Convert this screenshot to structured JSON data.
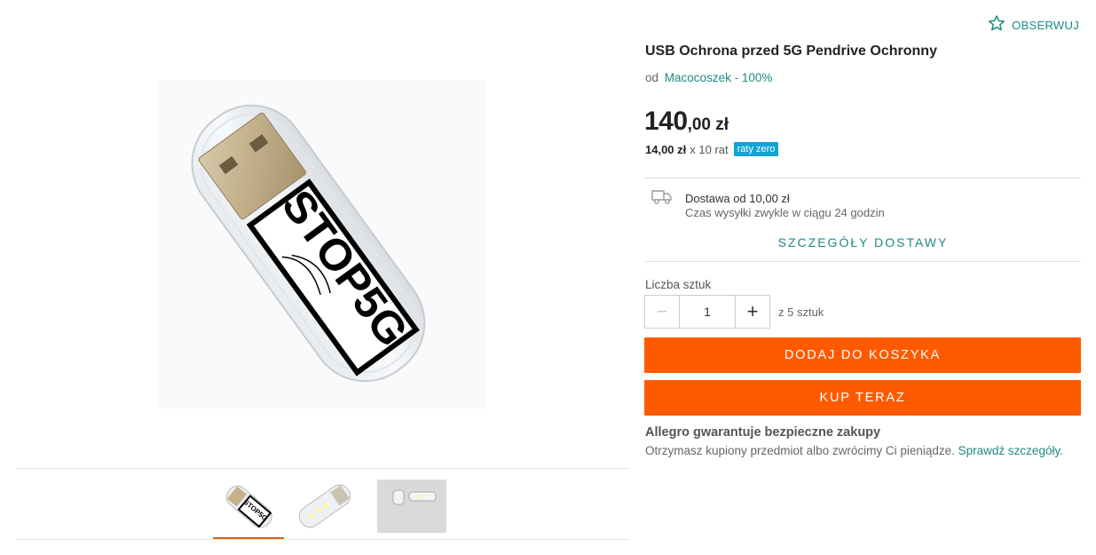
{
  "product": {
    "title": "USB Ochrona przed 5G Pendrive Ochronny",
    "seller_prefix": "od",
    "seller_name": "Macocoszek - 100%",
    "watch_label": "OBSERWUJ",
    "image_text": "STOP5G"
  },
  "price": {
    "integer": "140",
    "decimal": ",00 zł",
    "installment_amount": "14,00 zł",
    "installment_count": "x 10 rat",
    "installment_badge": "raty zero"
  },
  "delivery": {
    "line1": "Dostawa od 10,00 zł",
    "line2": "Czas wysyłki zwykle w ciągu 24 godzin",
    "details_link": "SZCZEGÓŁY DOSTAWY",
    "icon": "truck-icon"
  },
  "quantity": {
    "label": "Liczba sztuk",
    "value": "1",
    "available": "z 5 sztuk",
    "minus": "−",
    "plus": "+"
  },
  "actions": {
    "add_to_cart": "DODAJ DO KOSZYKA",
    "buy_now": "KUP TERAZ"
  },
  "guarantee": {
    "title": "Allegro gwarantuje bezpieczne zakupy",
    "text": "Otrzymasz kupiony przedmiot albo zwrócimy Ci pieniądze.",
    "link": "Sprawdź szczegóły",
    "period": "."
  },
  "gallery": {
    "thumbnails": [
      "thumbnail-stop5g-usb",
      "thumbnail-usb-led",
      "thumbnail-usb-pair"
    ],
    "active_index": 0
  },
  "colors": {
    "accent_teal": "#1c8a84",
    "orange": "#ff5a00",
    "badge_blue": "#10a4d4"
  }
}
